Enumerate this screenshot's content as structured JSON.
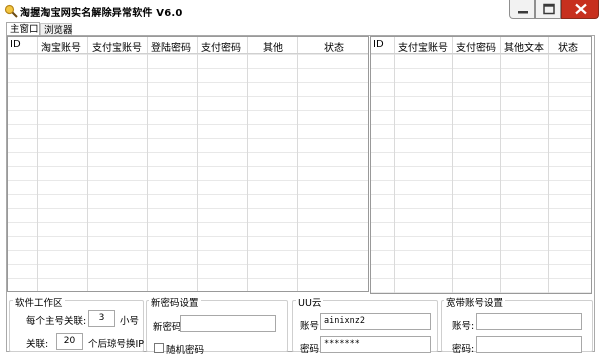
{
  "window": {
    "title": "淘握淘宝网实名解除异常软件   V6.0",
    "close_color": "#c7301e"
  },
  "tabs": [
    {
      "label": "主窗口",
      "selected": true
    },
    {
      "label": "浏览器",
      "selected": false
    }
  ],
  "left_table": {
    "columns": [
      "ID",
      "淘宝账号",
      "支付宝账号",
      "登陆密码",
      "支付密码",
      "其他",
      "状态"
    ],
    "rows": []
  },
  "right_table": {
    "columns": [
      "ID",
      "支付宝账号",
      "支付密码",
      "其他文本",
      "状态"
    ],
    "rows": []
  },
  "software_work": {
    "title": "软件工作区",
    "per_account_label": "每个主号关联:",
    "per_account_value": "3",
    "per_account_unit": "小号",
    "link_label": "关联:",
    "link_value": "20",
    "link_unit": "个后琼号换IP"
  },
  "new_password": {
    "title": "新密码设置",
    "label": "新密码:",
    "value": "",
    "random_label": "随机密码",
    "random_checked": false
  },
  "uu_cloud": {
    "title": "UU云",
    "account_label": "账号:",
    "account_value": "ainixnz2",
    "password_label": "密码:",
    "password_value": "*******"
  },
  "broadband": {
    "title": "宽带账号设置",
    "account_label": "账号:",
    "account_value": "",
    "password_label": "密码:",
    "password_value": ""
  }
}
